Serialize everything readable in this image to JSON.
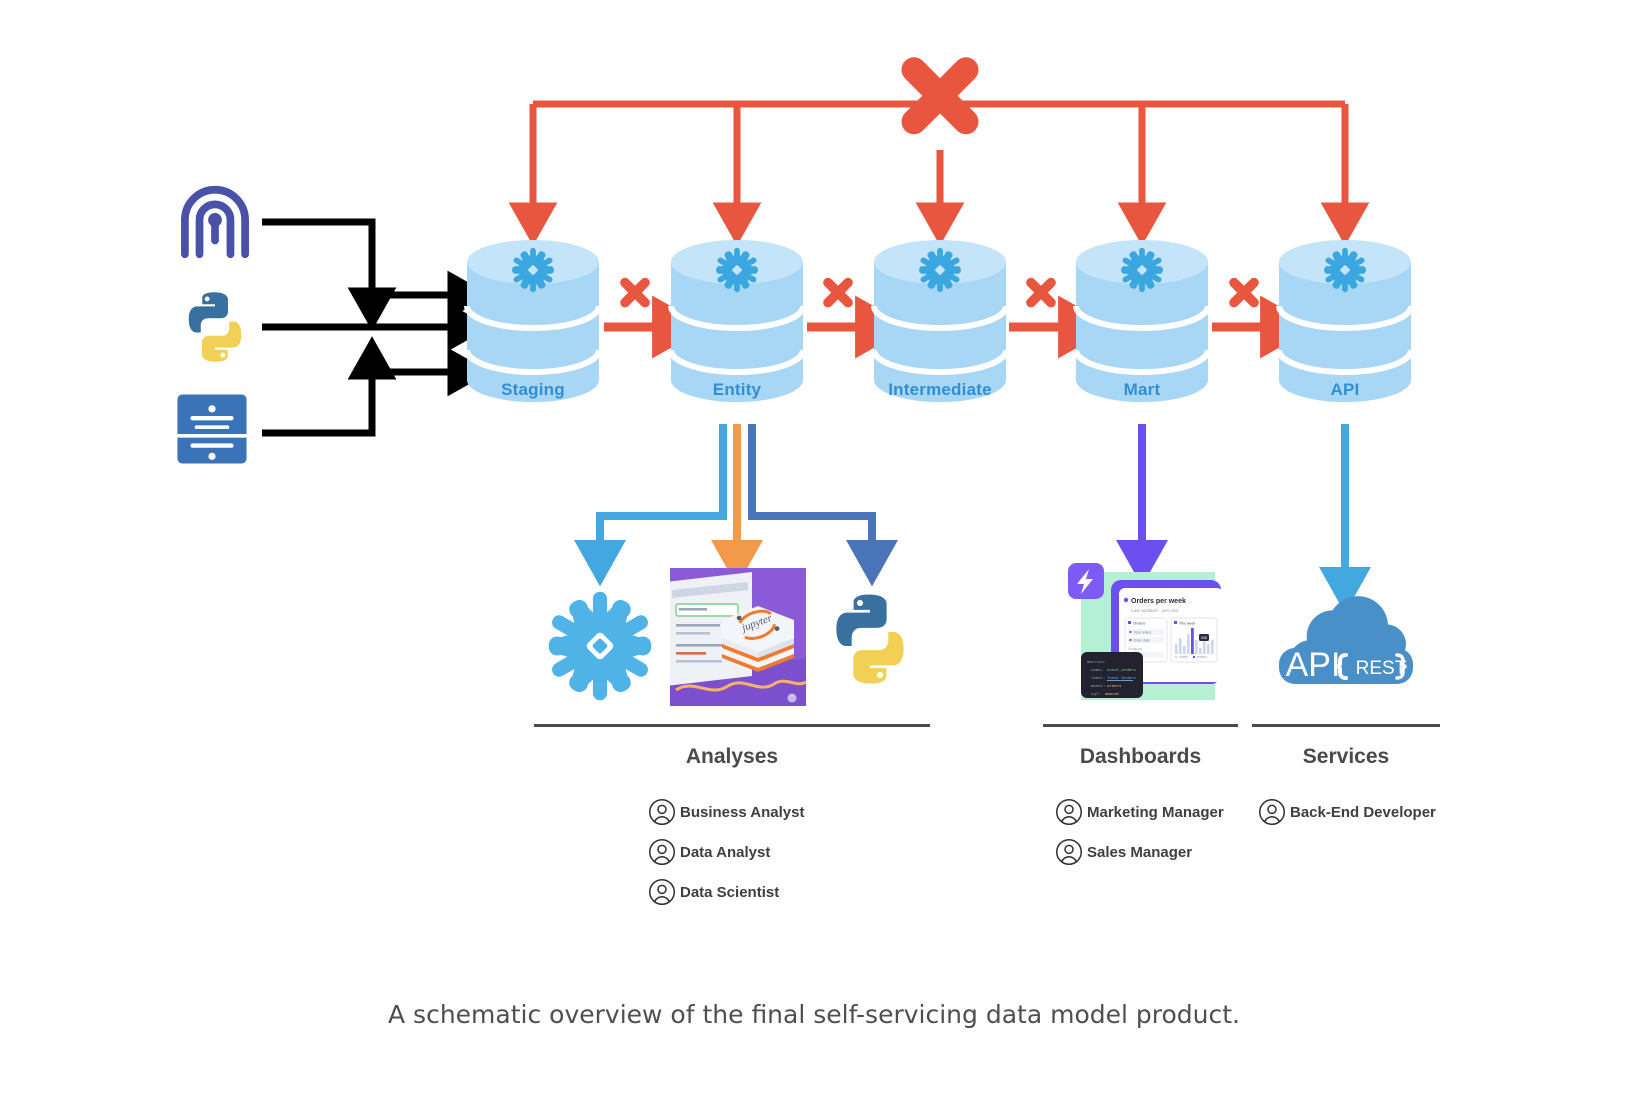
{
  "diagram": {
    "title_caption": "A schematic overview of the final self-servicing data model product.",
    "colors": {
      "dbt_red": "#e8563f",
      "snowflake_blue": "#3aa7e0",
      "cylinder_body": "#a8d6f5",
      "cylinder_top": "#c4e4fa",
      "cylinder_label": "#2f8fd4",
      "python_blue": "#3871a0",
      "python_yellow": "#f2cf55",
      "meltano_purple": "#4a51a8",
      "airflow_blue": "#3b73b9",
      "orange_arrow": "#f2994a",
      "lightblue_arrow": "#43a8e0",
      "darkblue_arrow": "#4a74b8",
      "purple_arrow": "#6c4ff0",
      "black_arrow": "#000000",
      "text_dark": "#4a4a4a"
    },
    "sources": [
      {
        "id": "meltano",
        "icon": "meltano-logo-icon",
        "label": "Meltano"
      },
      {
        "id": "python",
        "icon": "python-logo-icon",
        "label": "Python"
      },
      {
        "id": "database",
        "icon": "database-source-icon",
        "label": "Database"
      }
    ],
    "orchestrator": {
      "icon": "dbt-logo-icon",
      "label": "dbt"
    },
    "layers": [
      {
        "id": "staging",
        "label": "Staging",
        "icon": "snowflake-icon"
      },
      {
        "id": "entity",
        "label": "Entity",
        "icon": "snowflake-icon"
      },
      {
        "id": "intermediate",
        "label": "Intermediate",
        "icon": "snowflake-icon"
      },
      {
        "id": "mart",
        "label": "Mart",
        "icon": "snowflake-icon"
      },
      {
        "id": "api",
        "label": "API",
        "icon": "snowflake-icon"
      }
    ],
    "transform_markers": [
      {
        "id": "staging-to-entity",
        "icon": "dbt-logo-icon"
      },
      {
        "id": "entity-to-intermediate",
        "icon": "dbt-logo-icon"
      },
      {
        "id": "intermediate-to-mart",
        "icon": "dbt-logo-icon"
      },
      {
        "id": "mart-to-api",
        "icon": "dbt-logo-icon"
      }
    ],
    "outputs": [
      {
        "id": "snowflake-ui",
        "icon": "snowflake-icon"
      },
      {
        "id": "jupyter",
        "icon": "jupyter-notebook-image",
        "label": "jupyter"
      },
      {
        "id": "python-out",
        "icon": "python-logo-icon"
      },
      {
        "id": "lightdash",
        "icon": "lightdash-dashboard-image",
        "label": "Orders per week"
      },
      {
        "id": "api-rest",
        "icon": "api-rest-cloud-icon",
        "label_api": "API",
        "label_rest": "REST"
      }
    ],
    "consumer_sections": [
      {
        "id": "analyses",
        "title": "Analyses",
        "personas": [
          "Business Analyst",
          "Data Analyst",
          "Data Scientist"
        ]
      },
      {
        "id": "dashboards",
        "title": "Dashboards",
        "personas": [
          "Marketing Manager",
          "Sales Manager"
        ]
      },
      {
        "id": "services",
        "title": "Services",
        "personas": [
          "Back-End Developer"
        ]
      }
    ]
  }
}
